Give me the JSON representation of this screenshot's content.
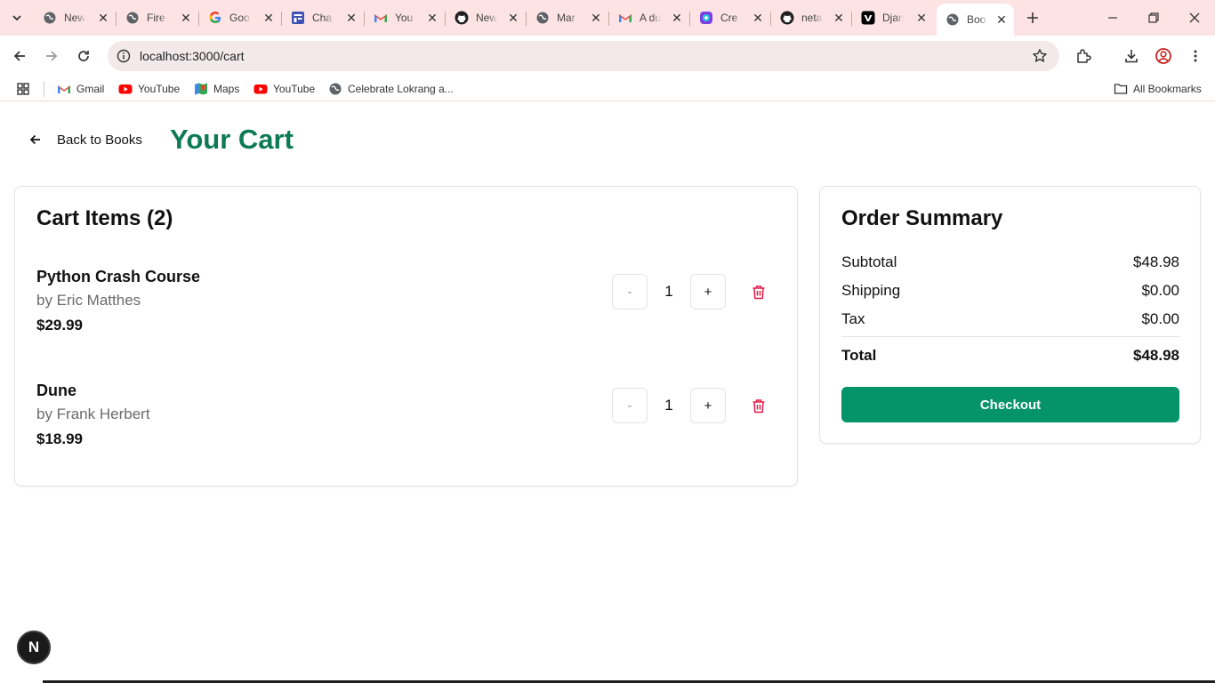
{
  "browser": {
    "tabs": [
      {
        "title": "New",
        "icon": "globe-icon"
      },
      {
        "title": "Fire",
        "icon": "globe-icon"
      },
      {
        "title": "Goo",
        "icon": "google-icon"
      },
      {
        "title": "Cha",
        "icon": "form-icon"
      },
      {
        "title": "You",
        "icon": "gmail-icon"
      },
      {
        "title": "New",
        "icon": "github-icon"
      },
      {
        "title": "Mar",
        "icon": "globe-icon"
      },
      {
        "title": "A du",
        "icon": "gmail-icon"
      },
      {
        "title": "Cre",
        "icon": "canva-icon"
      },
      {
        "title": "neta",
        "icon": "github-icon"
      },
      {
        "title": "Djan",
        "icon": "vercel-icon"
      },
      {
        "title": "Boo",
        "icon": "globe-icon",
        "active": true
      }
    ],
    "url": "localhost:3000/cart",
    "bookmarks": [
      {
        "label": "Gmail",
        "icon": "gmail-icon"
      },
      {
        "label": "YouTube",
        "icon": "youtube-icon"
      },
      {
        "label": "Maps",
        "icon": "maps-icon"
      },
      {
        "label": "YouTube",
        "icon": "youtube-icon"
      },
      {
        "label": "Celebrate Lokrang a...",
        "icon": "globe-icon"
      }
    ],
    "all_bookmarks": "All Bookmarks"
  },
  "page": {
    "back_label": "Back to Books",
    "title": "Your Cart",
    "accent_color": "#0c7a55",
    "button_color": "#05936a",
    "danger_color": "#e11d48"
  },
  "cart": {
    "heading": "Cart Items (2)",
    "minus_label": "-",
    "plus_label": "+",
    "items": [
      {
        "title": "Python Crash Course",
        "author": "by Eric Matthes",
        "price": "$29.99",
        "quantity": "1"
      },
      {
        "title": "Dune",
        "author": "by Frank Herbert",
        "price": "$18.99",
        "quantity": "1"
      }
    ]
  },
  "summary": {
    "heading": "Order Summary",
    "subtotal_label": "Subtotal",
    "subtotal_value": "$48.98",
    "shipping_label": "Shipping",
    "shipping_value": "$0.00",
    "tax_label": "Tax",
    "tax_value": "$0.00",
    "total_label": "Total",
    "total_value": "$48.98",
    "checkout_label": "Checkout"
  },
  "dev_badge": {
    "letter": "N"
  }
}
